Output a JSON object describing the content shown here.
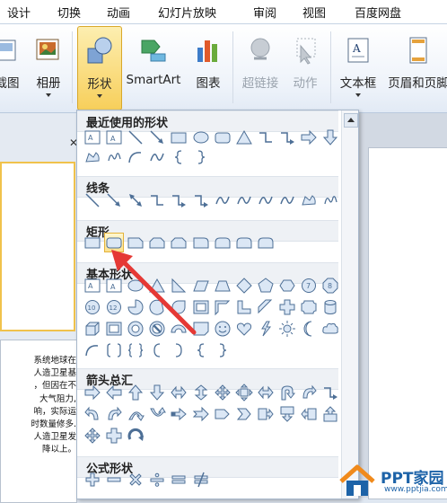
{
  "tabs": [
    "设计",
    "切换",
    "动画",
    "幻灯片放映",
    "审阅",
    "视图",
    "百度网盘"
  ],
  "ribbon": {
    "partial_left": "截图",
    "album": "相册",
    "shapes": "形状",
    "smartart": "SmartArt",
    "chart": "图表",
    "hyperlink": "超链接",
    "action": "动作",
    "textbox": "文本框",
    "header_footer": "页眉和页脚"
  },
  "gallery": {
    "recent": "最近使用的形状",
    "lines": "线条",
    "rectangles": "矩形",
    "basic": "基本形状",
    "arrows": "箭头总汇",
    "equation": "公式形状"
  },
  "slide_text": [
    "系统地球在",
    "人造卫星基",
    "，但因在不",
    "大气阻力,",
    "响，实际运",
    "时数量修多.",
    "人造卫星发",
    "降以上。"
  ],
  "watermark": {
    "title": "PPT家园",
    "url": "www.pptjia.com"
  },
  "colors": {
    "accent": "#f7cf5b",
    "arrow": "#e53935",
    "shape_fill": "#dbe7f5",
    "shape_stroke": "#4d6f96"
  }
}
